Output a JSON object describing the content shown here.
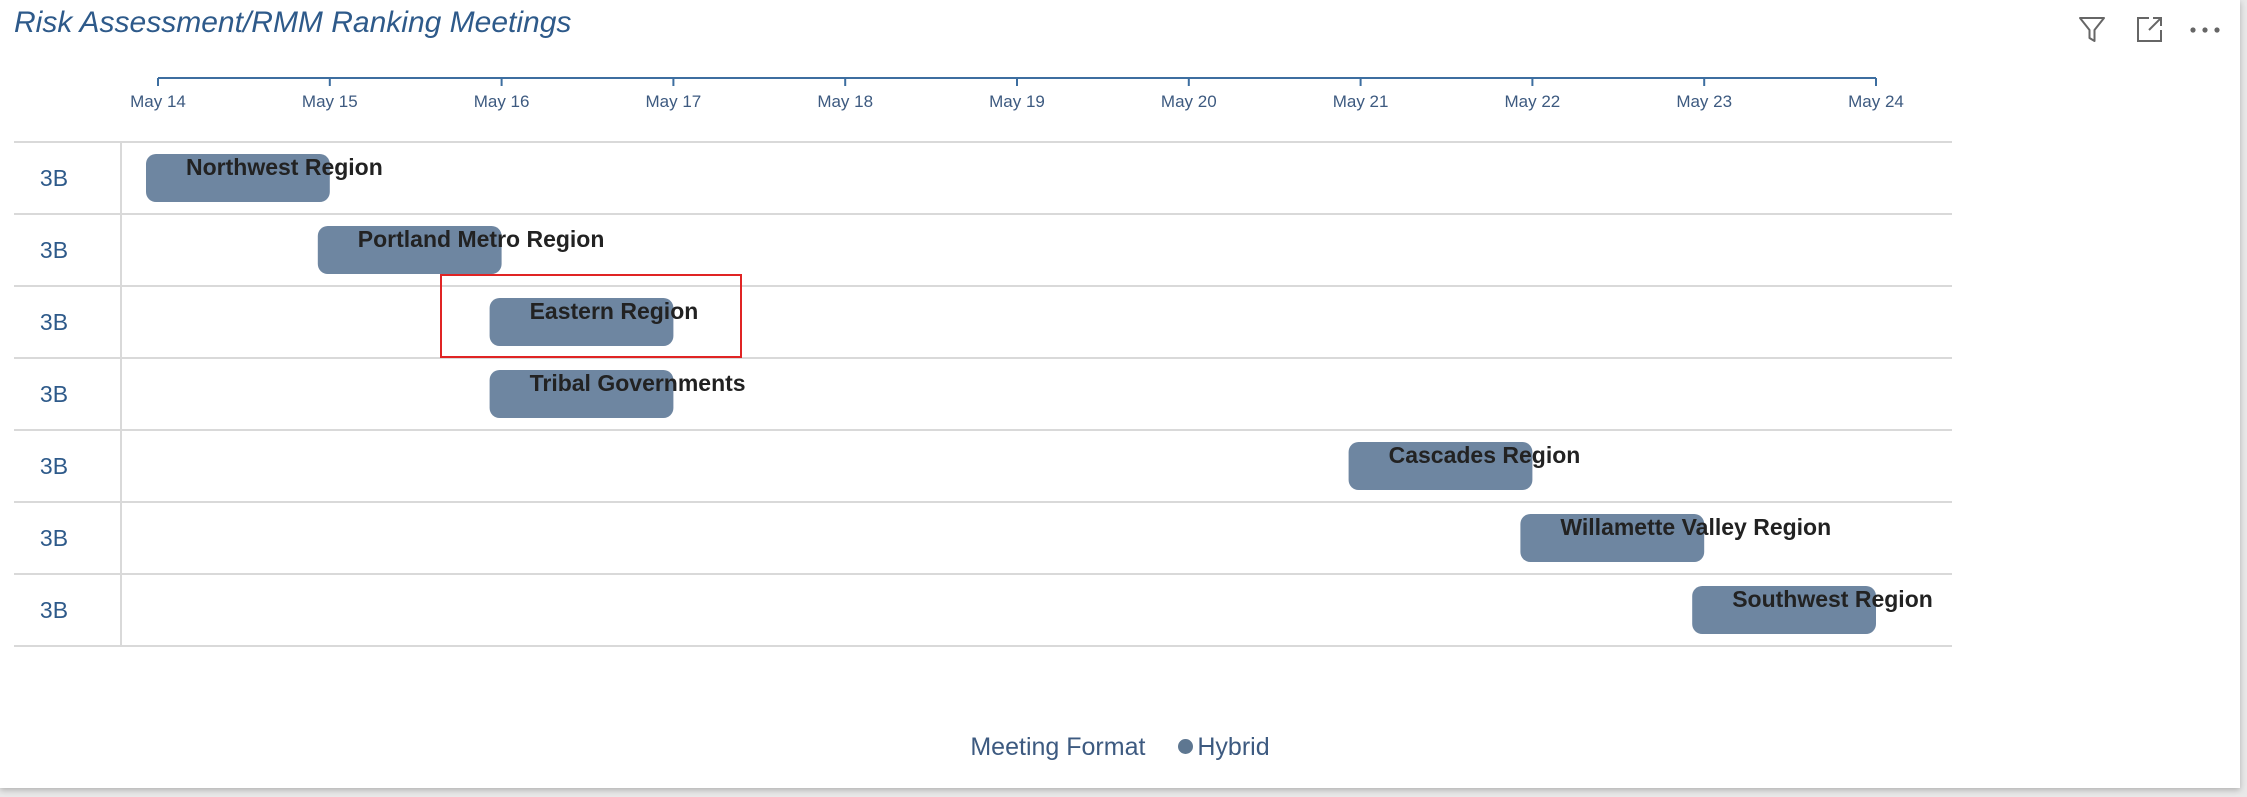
{
  "header": {
    "title": "Risk Assessment/RMM Ranking Meetings",
    "icons": [
      "filter-icon",
      "focus-mode-icon",
      "more-options-icon"
    ]
  },
  "legend": {
    "title": "Meeting Format",
    "items": [
      {
        "label": "Hybrid",
        "color": "#5e7791"
      }
    ]
  },
  "chart_data": {
    "type": "gantt",
    "title": "Risk Assessment/RMM Ranking Meetings",
    "x_ticks": [
      "May 14",
      "May 15",
      "May 16",
      "May 17",
      "May 18",
      "May 19",
      "May 20",
      "May 21",
      "May 22",
      "May 23",
      "May 24"
    ],
    "x_domain": [
      "May 14",
      "May 24"
    ],
    "rows": [
      {
        "category": "3B",
        "task": "Northwest Region",
        "start": "May 14",
        "end": "May 15",
        "format": "Hybrid"
      },
      {
        "category": "3B",
        "task": "Portland Metro Region",
        "start": "May 15",
        "end": "May 16",
        "format": "Hybrid"
      },
      {
        "category": "3B",
        "task": "Eastern Region",
        "start": "May 16",
        "end": "May 17",
        "format": "Hybrid",
        "highlighted": true
      },
      {
        "category": "3B",
        "task": "Tribal Governments",
        "start": "May 16",
        "end": "May 17",
        "format": "Hybrid"
      },
      {
        "category": "3B",
        "task": "Cascades Region",
        "start": "May 21",
        "end": "May 22",
        "format": "Hybrid"
      },
      {
        "category": "3B",
        "task": "Willamette Valley Region",
        "start": "May 22",
        "end": "May 23",
        "format": "Hybrid"
      },
      {
        "category": "3B",
        "task": "Southwest Region",
        "start": "May 23",
        "end": "May 24",
        "format": "Hybrid"
      }
    ],
    "colors": {
      "bar": "#6e86a1",
      "axis": "#3d6ea0",
      "grid": "#d9d9d9",
      "highlight": "#e02424"
    },
    "grid": true,
    "legend_position": "bottom-center"
  }
}
